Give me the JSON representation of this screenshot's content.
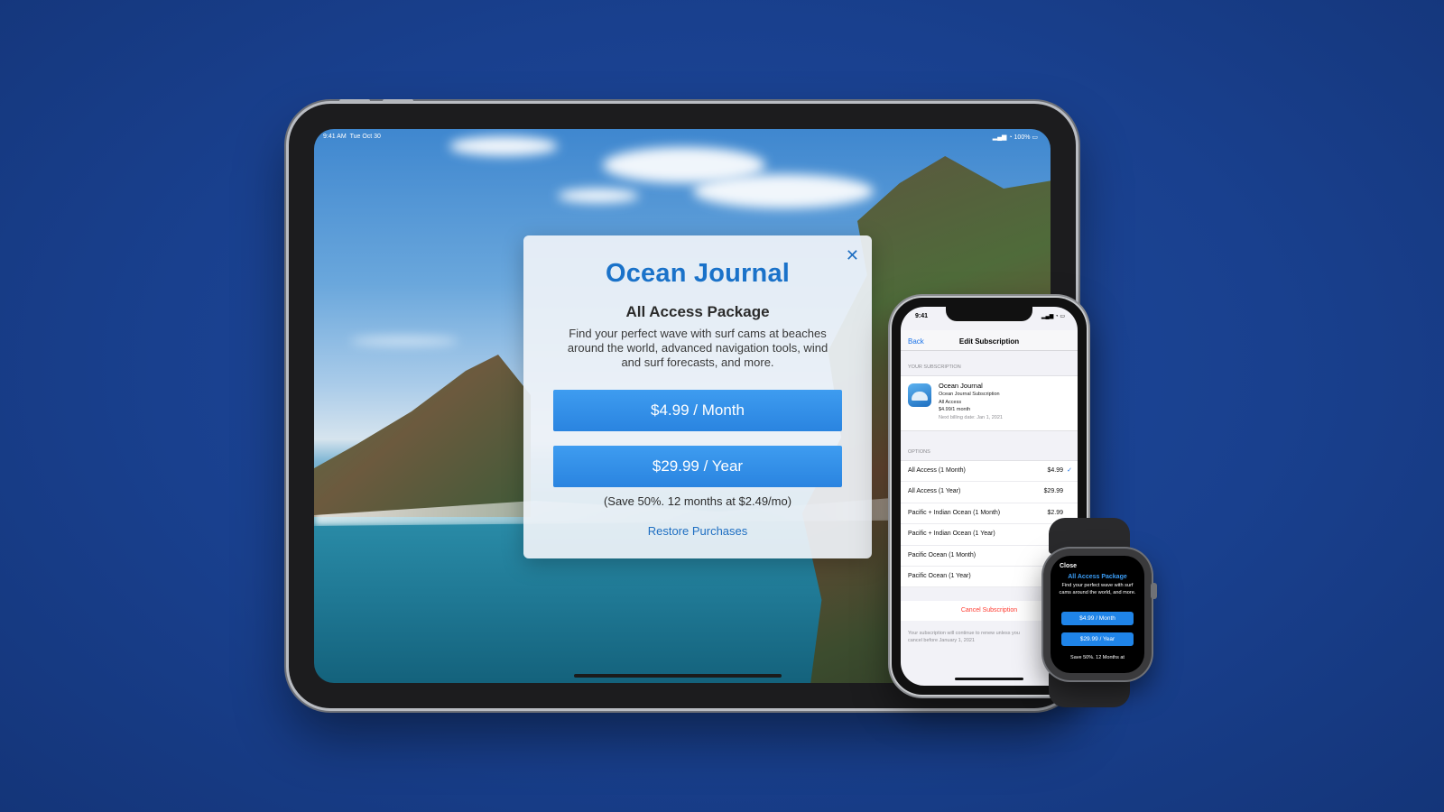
{
  "ipad": {
    "status_time": "9:41 AM",
    "status_date": "Tue Oct 30",
    "status_right": "▂▄▆ ◔ 100% ▭"
  },
  "paywall": {
    "app_title": "Ocean Journal",
    "package_title": "All Access Package",
    "description": "Find your perfect wave with surf cams at beaches around the world, advanced navigation tools, wind and surf forecasts, and more.",
    "monthly_button": "$4.99 / Month",
    "yearly_button": "$29.99 / Year",
    "save_note": "(Save 50%. 12 months at $2.49/mo)",
    "restore_link": "Restore Purchases",
    "close_glyph": "✕"
  },
  "iphone": {
    "status_time": "9:41",
    "status_right": "▂▄▆ ◔ ▭",
    "nav_back": "Back",
    "nav_title": "Edit Subscription",
    "your_subscription_header": "YOUR SUBSCRIPTION",
    "subscription": {
      "app_name": "Ocean Journal",
      "product": "Ocean Journal Subscription",
      "tier": "All Access",
      "price": "$4.99/1 month",
      "next_billing": "Next billing date: Jan 1, 2021"
    },
    "options_header": "OPTIONS",
    "options": [
      {
        "name": "All Access (1 Month)",
        "price": "$4.99",
        "check": "✓"
      },
      {
        "name": "All Access (1 Year)",
        "price": "$29.99",
        "check": ""
      },
      {
        "name": "Pacific + Indian Ocean (1 Month)",
        "price": "$2.99",
        "check": ""
      },
      {
        "name": "Pacific + Indian Ocean (1 Year)",
        "price": "$",
        "check": ""
      },
      {
        "name": "Pacific Ocean (1 Month)",
        "price": "",
        "check": ""
      },
      {
        "name": "Pacific Ocean (1 Year)",
        "price": "",
        "check": ""
      }
    ],
    "cancel_label": "Cancel Subscription",
    "footnote": "Your subscription will continue to renew unless you cancel before January 1, 2021"
  },
  "watch": {
    "close_label": "Close",
    "package_title": "All Access Package",
    "description": "Find your perfect wave with surf cams around the world, and more.",
    "monthly_button": "$4.99 / Month",
    "yearly_button": "$29.99 / Year",
    "save_note": "Save 50%. 12 Months at"
  },
  "colors": {
    "background": "#1a428f",
    "accent": "#2a84e0",
    "title_blue": "#1a72c9",
    "destructive": "#ff3b30"
  }
}
